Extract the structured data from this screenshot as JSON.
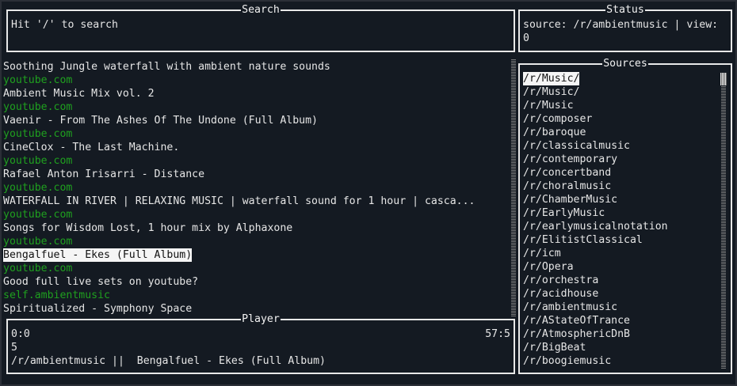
{
  "search": {
    "title": "Search",
    "hint": "Hit '/' to search"
  },
  "status": {
    "title": "Status",
    "line1": "source: /r/ambientmusic | view:",
    "line2": "0"
  },
  "posts": [
    {
      "title": "Soothing Jungle waterfall with ambient nature sounds",
      "domain": "youtube.com"
    },
    {
      "title": "Ambient Music Mix vol. 2",
      "domain": "youtube.com"
    },
    {
      "title": "Vaenir - From The Ashes Of The Undone (Full Album)",
      "domain": "youtube.com"
    },
    {
      "title": "CineClox - The Last Machine.",
      "domain": "youtube.com"
    },
    {
      "title": "Rafael Anton Irisarri - Distance",
      "domain": "youtube.com"
    },
    {
      "title": "WATERFALL IN RIVER | RELAXING MUSIC | waterfall sound for 1 hour | casca...",
      "domain": "youtube.com"
    },
    {
      "title": "Songs for Wisdom Lost, 1 hour mix by Alphaxone",
      "domain": "youtube.com"
    },
    {
      "title": "Bengalfuel - Ekes (Full Album)",
      "domain": "youtube.com",
      "selected": true
    },
    {
      "title": "Good full live sets on youtube?",
      "domain": "self.ambientmusic"
    },
    {
      "title": "Spiritualized - Symphony Space",
      "domain": ""
    }
  ],
  "player": {
    "title": "Player",
    "elapsed": "0:0",
    "duration": "57:5",
    "line2": "5",
    "now_playing": "/r/ambientmusic ||  Bengalfuel - Ekes (Full Album)"
  },
  "sources": {
    "title": "Sources",
    "items": [
      "/r/Music/",
      "/r/Music/",
      "/r/Music",
      "/r/composer",
      "/r/baroque",
      "/r/classicalmusic",
      "/r/contemporary",
      "/r/concertband",
      "/r/choralmusic",
      "/r/ChamberMusic",
      "/r/EarlyMusic",
      "/r/earlymusicalnotation",
      "/r/ElitistClassical",
      "/r/icm",
      "/r/Opera",
      "/r/orchestra",
      "/r/acidhouse",
      "/r/ambientmusic",
      "/r/AStateOfTrance",
      "/r/AtmosphericDnB",
      "/r/BigBeat",
      "/r/boogiemusic"
    ]
  }
}
